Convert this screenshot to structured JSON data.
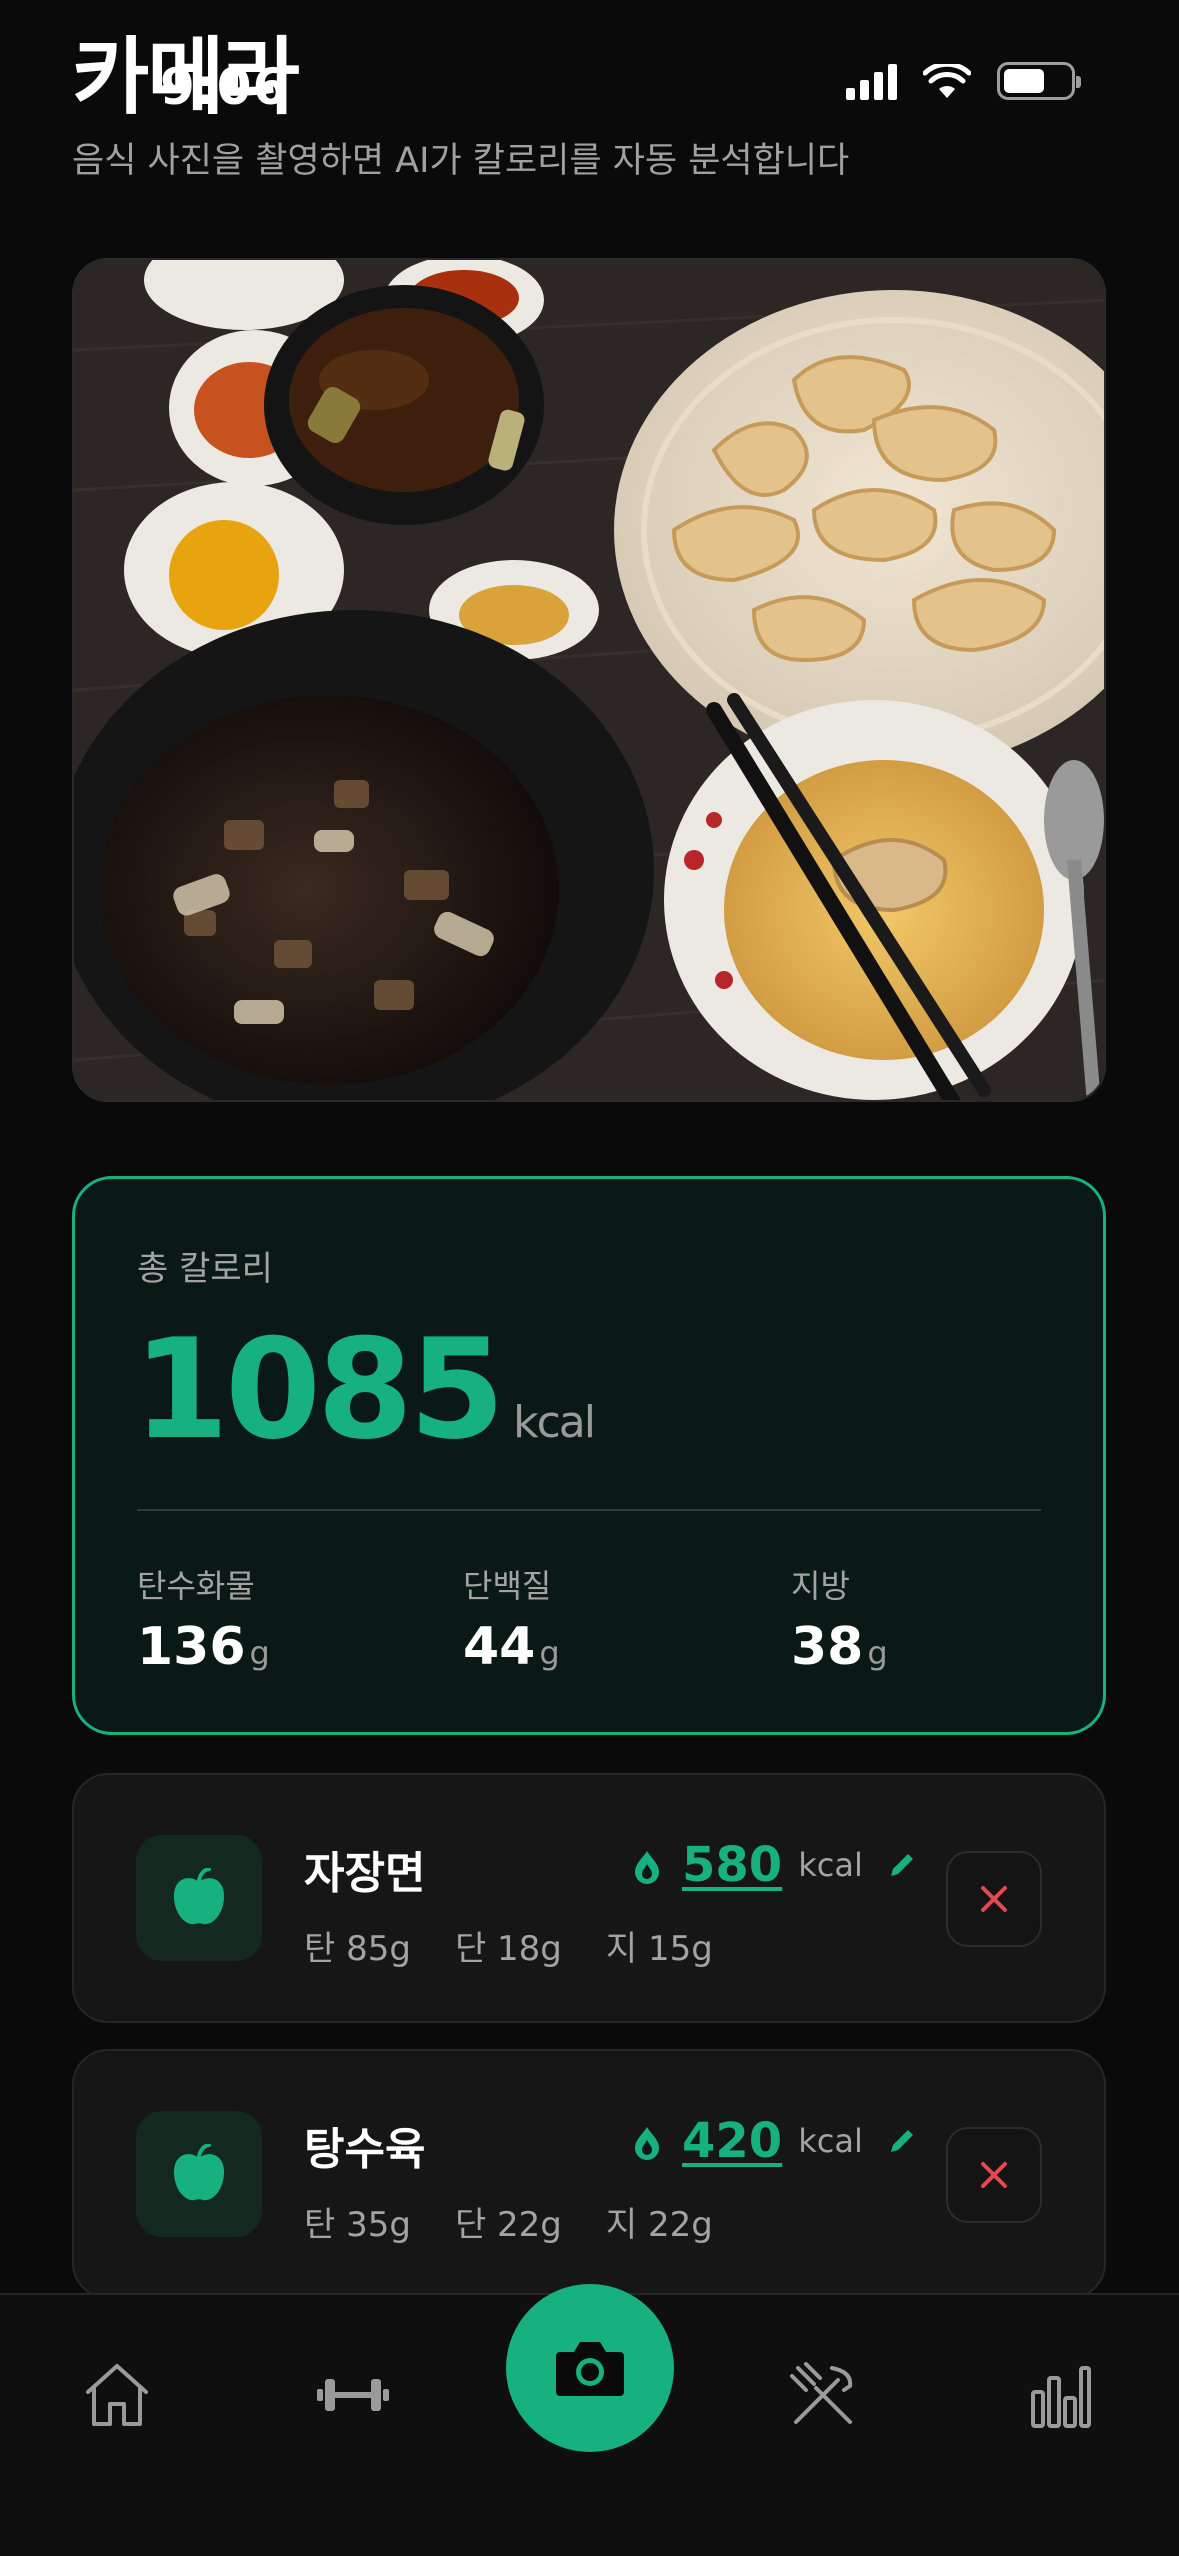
{
  "status_bar": {
    "time": "9:06"
  },
  "header": {
    "title": "카메라",
    "subtitle": "음식 사진을 촬영하면 AI가 칼로리를 자동 분석합니다"
  },
  "summary": {
    "label": "총 칼로리",
    "total": "1085",
    "unit": "kcal",
    "macros": [
      {
        "label": "탄수화물",
        "value": "136",
        "unit": "g"
      },
      {
        "label": "단백질",
        "value": "44",
        "unit": "g"
      },
      {
        "label": "지방",
        "value": "38",
        "unit": "g"
      }
    ]
  },
  "foods": [
    {
      "name": "자장면",
      "kcal": "580",
      "kcal_unit": "kcal",
      "carb": "탄 85g",
      "protein": "단 18g",
      "fat": "지 15g"
    },
    {
      "name": "탕수육",
      "kcal": "420",
      "kcal_unit": "kcal",
      "carb": "탄 35g",
      "protein": "단 22g",
      "fat": "지 22g"
    }
  ],
  "nav": {
    "items": [
      "home-icon",
      "dumbbell-icon",
      "camera-icon",
      "fork-knife-icon",
      "bar-chart-icon"
    ],
    "active": "camera"
  },
  "colors": {
    "accent": "#17b17f",
    "delete": "#e5484d",
    "background": "#0a0a0a"
  }
}
